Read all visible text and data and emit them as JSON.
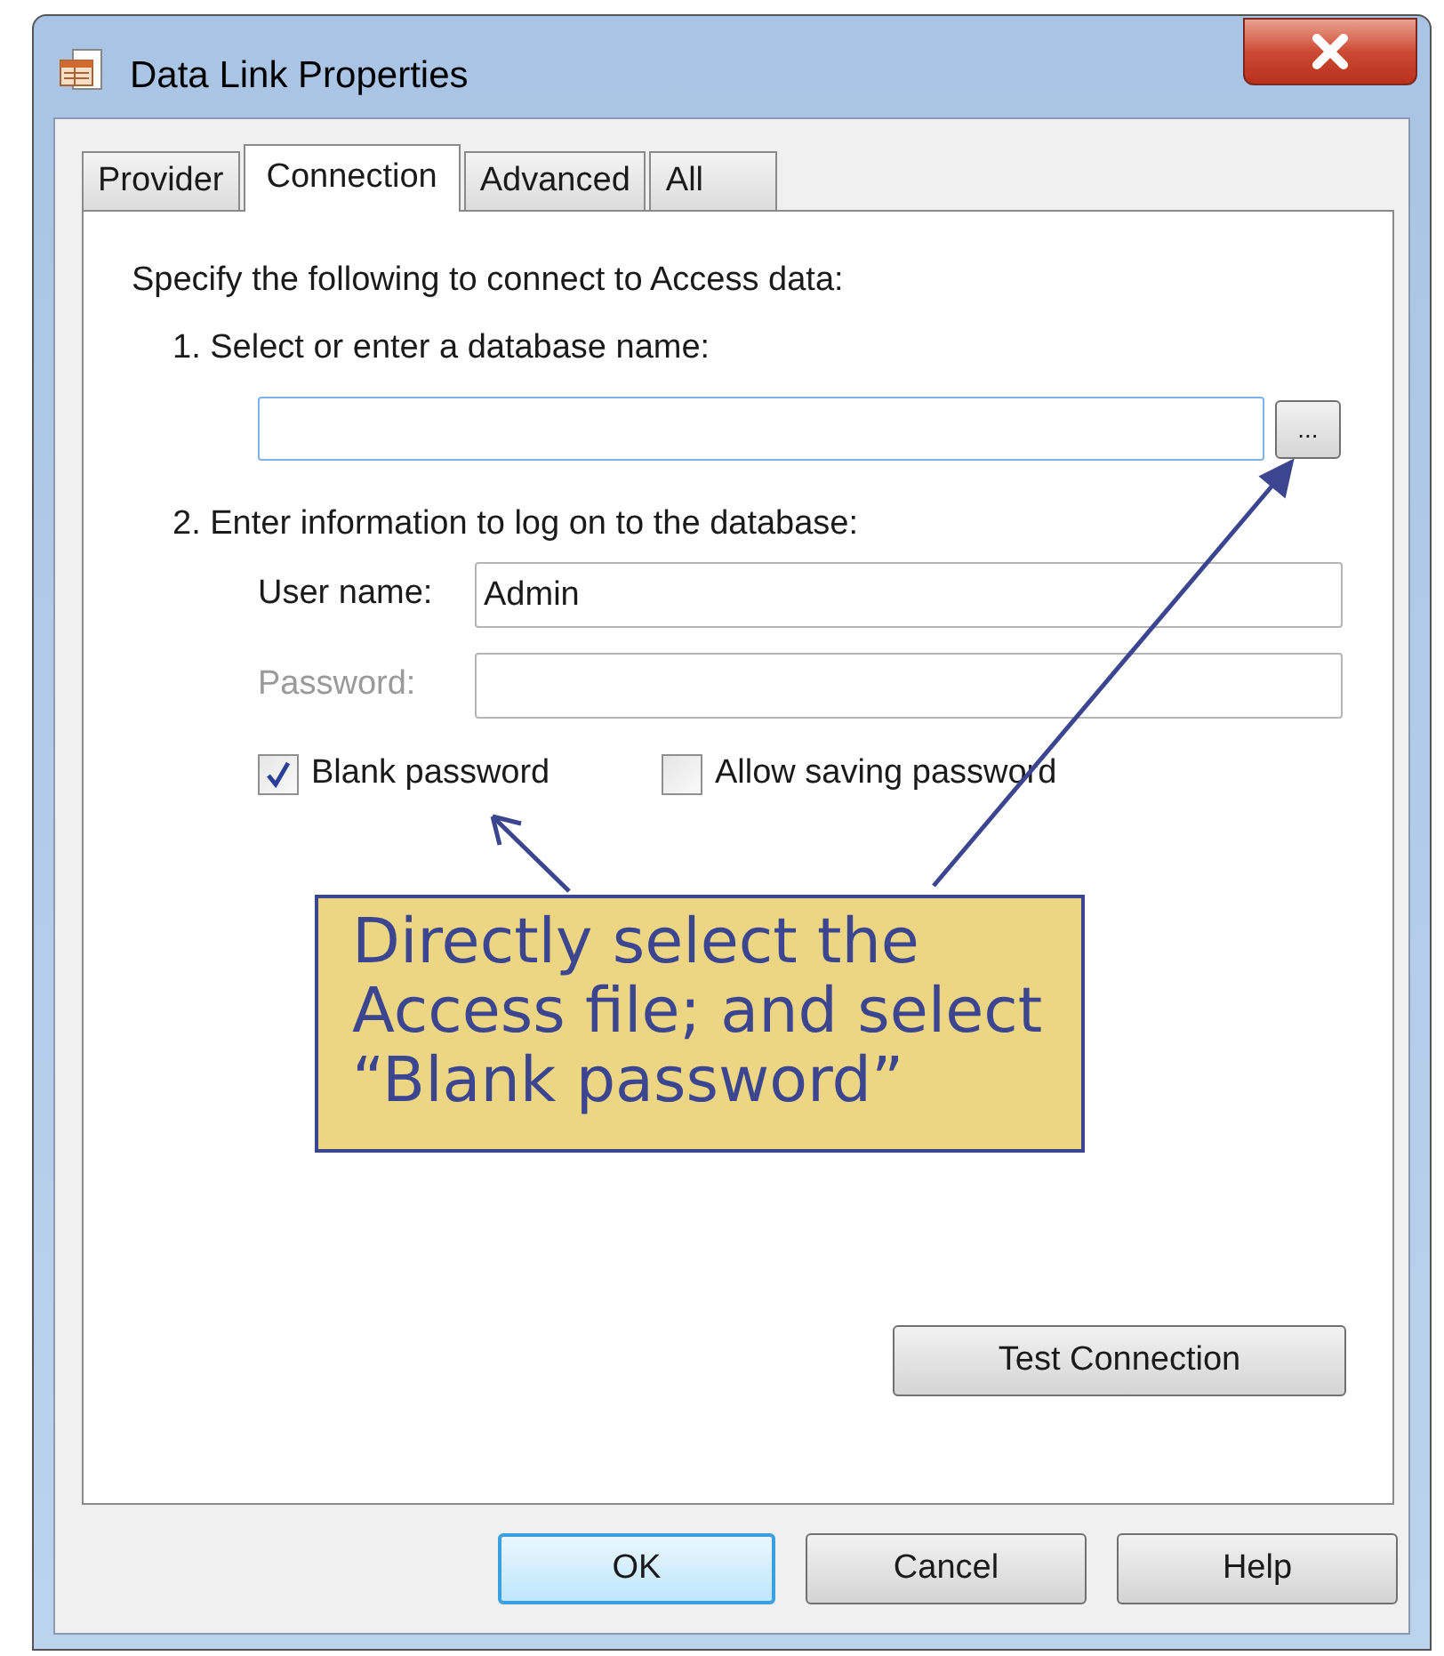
{
  "window": {
    "title": "Data Link Properties"
  },
  "tabs": [
    {
      "label": "Provider",
      "selected": false
    },
    {
      "label": "Connection",
      "selected": true
    },
    {
      "label": "Advanced",
      "selected": false
    },
    {
      "label": "All",
      "selected": false
    }
  ],
  "connection": {
    "intro": "Specify the following to connect to Access data:",
    "step_1": "1. Select or enter a database name:",
    "browse_button": "...",
    "step_2": "2. Enter information to log on to the database:",
    "fields": [
      {
        "label": "User name:",
        "value": "Admin",
        "disabled": false
      },
      {
        "label": "Password:",
        "disabled": true
      }
    ],
    "checkboxes": [
      {
        "label": "Blank password",
        "checked": true
      },
      {
        "label": "Allow saving password",
        "checked": false
      }
    ],
    "test_button": "Test Connection"
  },
  "buttons": [
    {
      "label": "OK",
      "default": true
    },
    {
      "label": "Cancel",
      "default": false
    },
    {
      "label": "Help",
      "default": false
    }
  ],
  "callout": {
    "text": "Directly select the\nAccess file; and select\n“Blank password”"
  }
}
